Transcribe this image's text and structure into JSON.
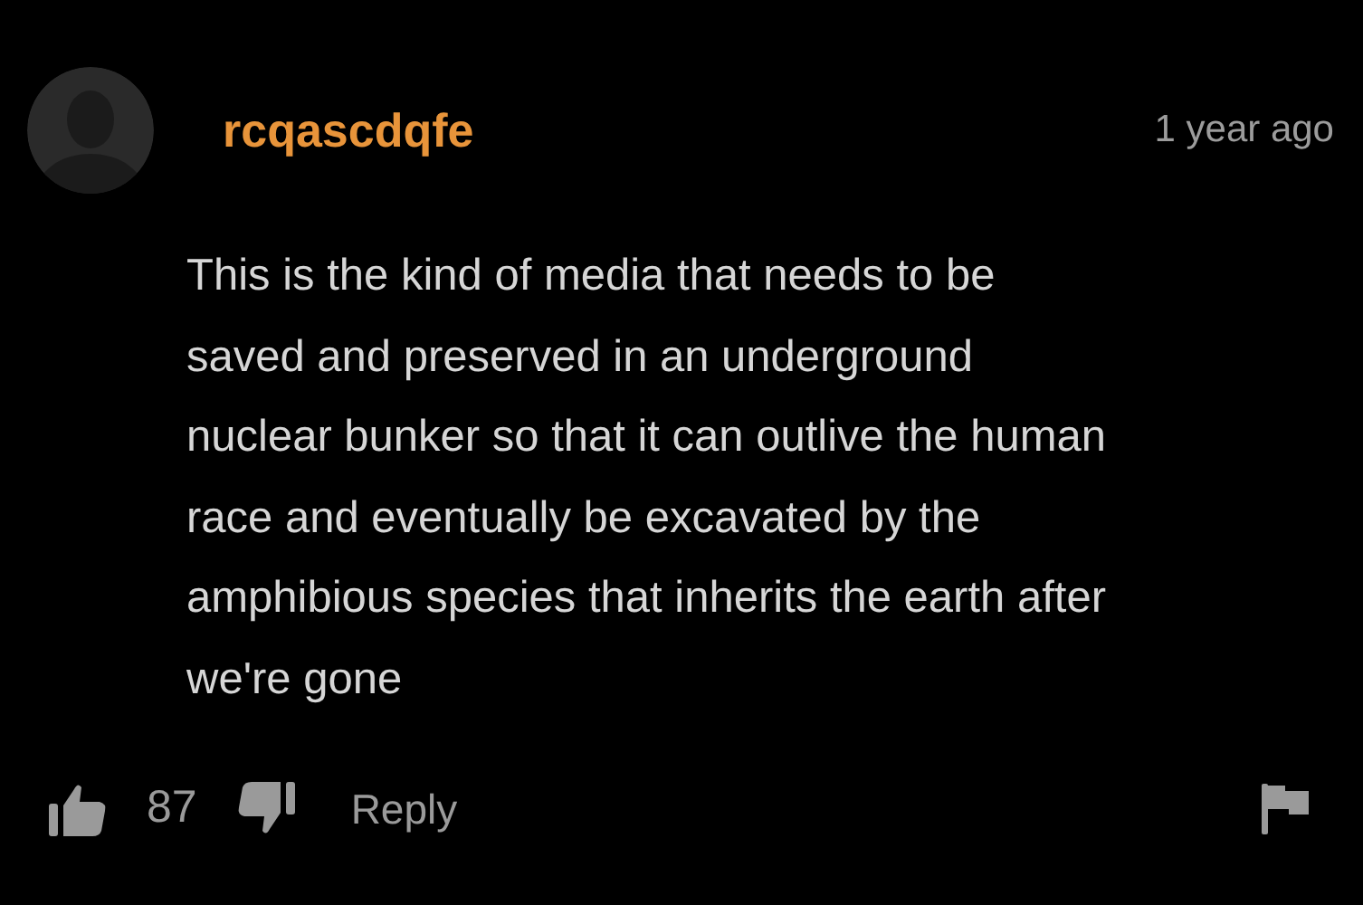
{
  "comment": {
    "author": "rcqascdqfe",
    "time": "1 year ago",
    "body_lines": [
      "This is the kind of media that needs to be",
      "saved and preserved in an underground",
      "nuclear bunker so that it can outlive the human",
      "race and eventually be excavated by the",
      "amphibious species that inherits the earth after",
      "we're gone"
    ],
    "likes": "87",
    "reply": "Reply"
  }
}
